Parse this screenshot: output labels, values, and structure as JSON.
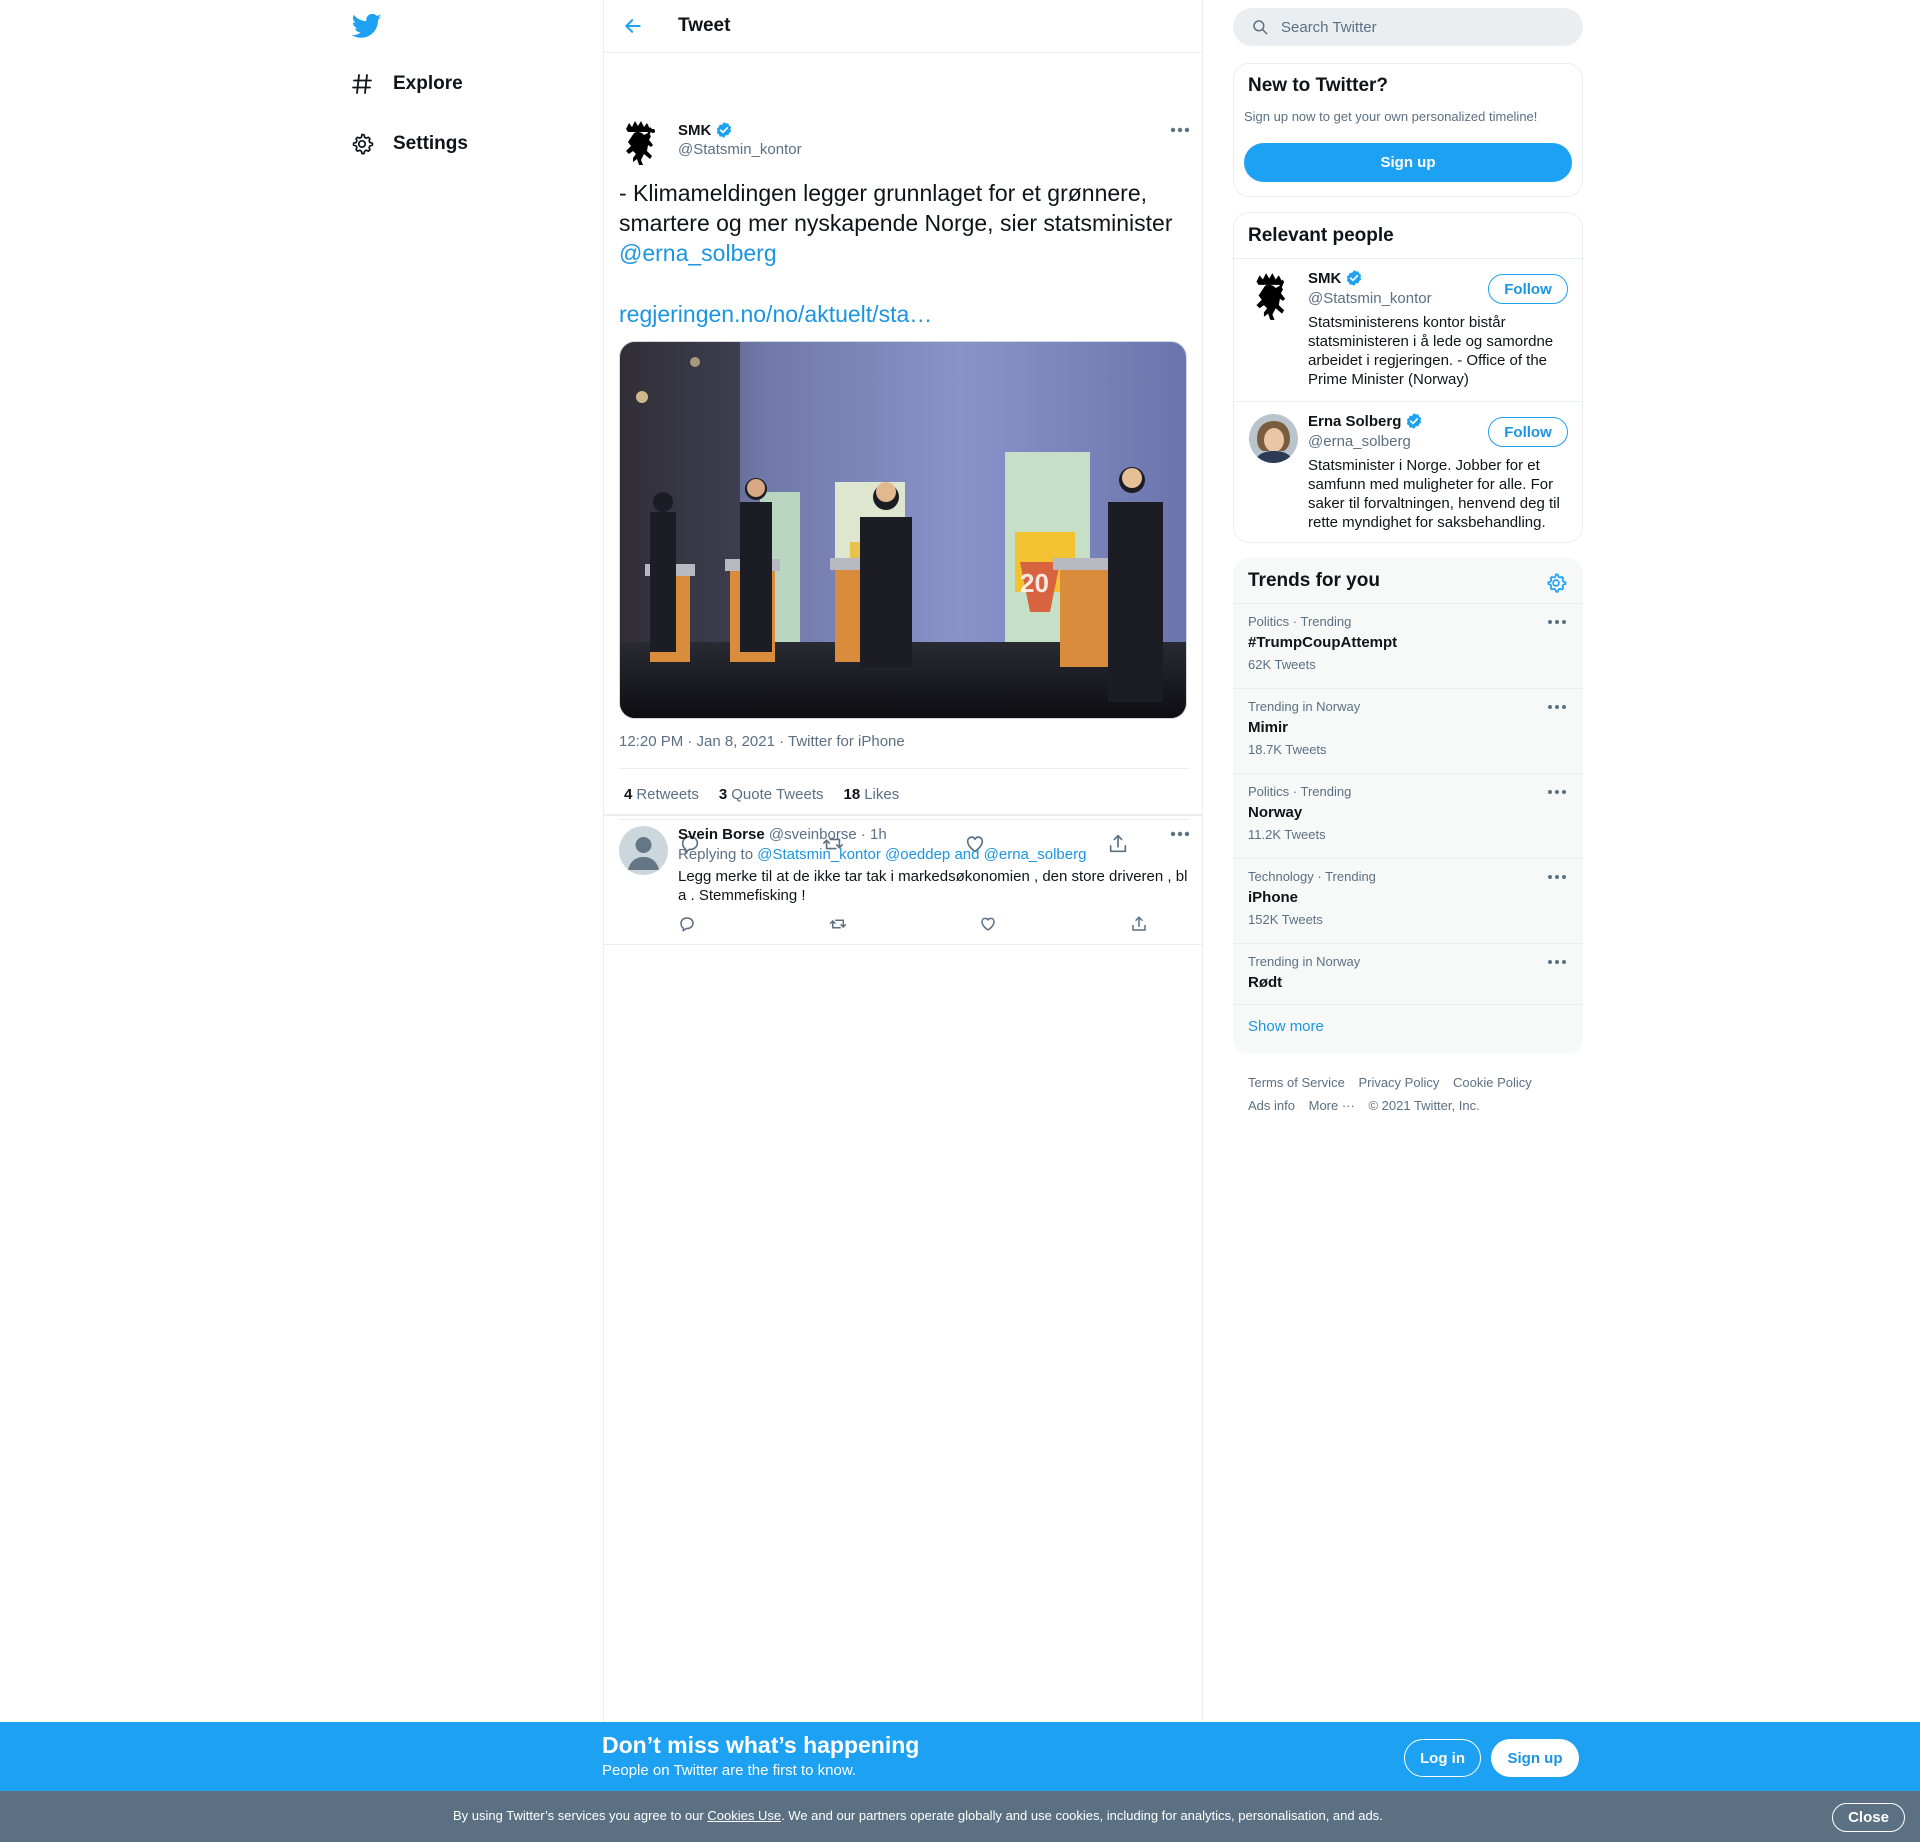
{
  "colors": {
    "brand": "#1da1f2",
    "link": "#1b95e0",
    "text": "#0f1419",
    "muted": "#5b7083",
    "cookie_bar": "#5b7083"
  },
  "nav": {
    "logo_icon": "twitter-bird-icon",
    "items": [
      {
        "label": "Explore",
        "icon": "hashtag-icon"
      },
      {
        "label": "Settings",
        "icon": "gear-icon"
      }
    ]
  },
  "header": {
    "back_icon": "arrow-left-icon",
    "title": "Tweet"
  },
  "tweet": {
    "author_name": "SMK",
    "author_handle": "@Statsmin_kontor",
    "verified": true,
    "text": "- Klimameldingen legger grunnlaget for et grønnere, smartere og mer nyskapende Norge, sier statsminister ",
    "mention": "@erna_solberg",
    "link": "regjeringen.no/no/aktuelt/sta…",
    "timestamp": "12:20 PM · Jan 8, 2021",
    "source": "Twitter for iPhone",
    "stats": {
      "retweets_count": "4",
      "retweets_label": "Retweets",
      "quotes_count": "3",
      "quotes_label": "Quote Tweets",
      "likes_count": "18",
      "likes_label": "Likes"
    }
  },
  "reply": {
    "name": "Svein Borse",
    "handle": "@sveinborse",
    "time": "· 1h",
    "replying_prefix": "Replying to",
    "replying_to": "@Statsmin_kontor @oeddep and @erna_solberg",
    "text": "Legg merke til at de ikke tar tak i markedsøkonomien , den store driveren , bl a . Stemmefisking !"
  },
  "search": {
    "placeholder": "Search Twitter"
  },
  "new_to_twitter": {
    "title": "New to Twitter?",
    "subtitle": "Sign up now to get your own personalized timeline!",
    "button": "Sign up"
  },
  "relevant_people": {
    "title": "Relevant people",
    "people": [
      {
        "name": "SMK",
        "handle": "@Statsmin_kontor",
        "follow": "Follow",
        "bio": "Statsministerens kontor bistår statsministeren i å lede og samordne arbeidet i regjeringen. - Office of the Prime Minister (Norway)"
      },
      {
        "name": "Erna Solberg",
        "handle": "@erna_solberg",
        "follow": "Follow",
        "bio": "Statsminister i Norge. Jobber for et samfunn med muligheter for alle. For saker til forvaltningen, henvend deg til rette myndighet for saksbehandling."
      }
    ]
  },
  "trends": {
    "title": "Trends for you",
    "items": [
      {
        "context": "Politics · Trending",
        "name": "#TrumpCoupAttempt",
        "count": "62K Tweets"
      },
      {
        "context": "Trending in Norway",
        "name": "Mimir",
        "count": "18.7K Tweets"
      },
      {
        "context": "Politics · Trending",
        "name": "Norway",
        "count": "11.2K Tweets"
      },
      {
        "context": "Technology · Trending",
        "name": "iPhone",
        "count": "152K Tweets"
      },
      {
        "context": "Trending in Norway",
        "name": "Rødt",
        "count": ""
      }
    ],
    "show_more": "Show more"
  },
  "footer": {
    "terms": "Terms of Service",
    "privacy": "Privacy Policy",
    "cookie": "Cookie Policy",
    "ads": "Ads info",
    "more": "More ···",
    "copyright": "© 2021 Twitter, Inc."
  },
  "promo": {
    "title": "Don’t miss what’s happening",
    "subtitle": "People on Twitter are the first to know.",
    "login": "Log in",
    "signup": "Sign up"
  },
  "cookie_bar": {
    "prefix": "By using Twitter’s services you agree to our ",
    "link": "Cookies Use",
    "suffix": ". We and our partners operate globally and use cookies, including for analytics, personalisation, and ads.",
    "close": "Close"
  }
}
